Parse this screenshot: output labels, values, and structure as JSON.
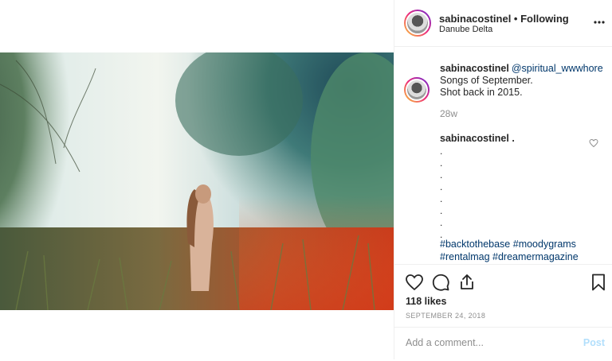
{
  "post": {
    "username": "sabinacostinel",
    "follow_status": " • Following",
    "location": "Danube Delta",
    "more_label": "•••"
  },
  "caption": {
    "username": "sabinacostinel",
    "mention": "@spiritual_wwwhore",
    "lines": [
      "Songs of September.",
      "Shot back in 2015."
    ],
    "time": "28w"
  },
  "comment": {
    "username": "sabinacostinel",
    "text": " .",
    "dots": [
      ".",
      ".",
      ".",
      ".",
      ".",
      ".",
      ".",
      "."
    ],
    "hashtags": [
      "#backtothebase #moodygrams",
      "#rentalmag #dreamermagazine"
    ]
  },
  "stats": {
    "likes": "118 likes",
    "date": "SEPTEMBER 24, 2018"
  },
  "composer": {
    "placeholder": "Add a comment...",
    "post_label": "Post"
  },
  "icons": [
    "heart-icon",
    "comment-icon",
    "share-icon",
    "bookmark-icon",
    "like-comment-heart-icon",
    "more-options-icon"
  ]
}
